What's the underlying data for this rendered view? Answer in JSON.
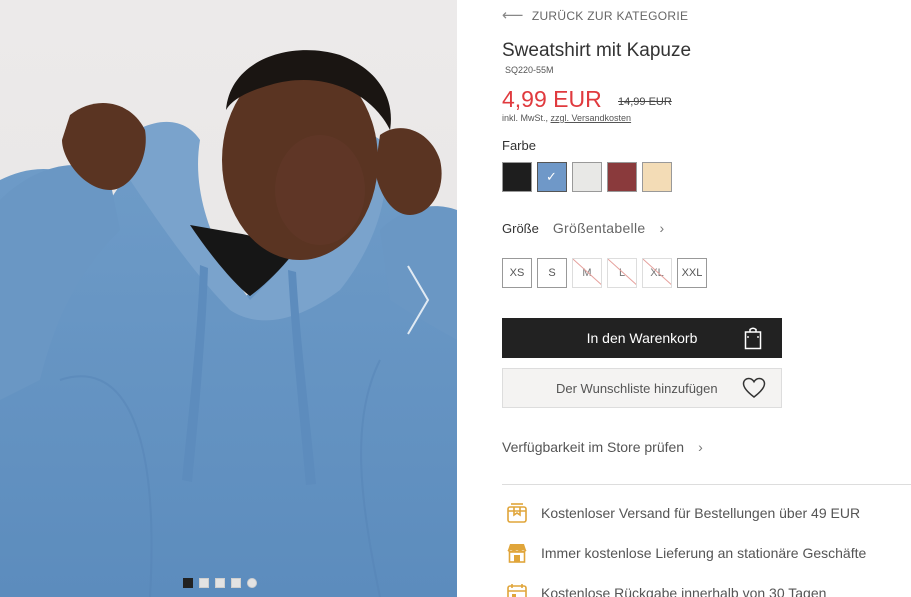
{
  "gallery": {
    "dots": [
      "active",
      "",
      "",
      "",
      "round"
    ]
  },
  "back_link": {
    "label": "ZURÜCK ZUR KATEGORIE"
  },
  "product": {
    "title": "Sweatshirt mit Kapuze",
    "sku": "SQ220-55M",
    "price": "4,99 EUR",
    "old_price": "14,99 EUR",
    "tax_prefix": "inkl. MwSt., ",
    "tax_link": "zzgl. Versandkosten"
  },
  "color": {
    "label": "Farbe",
    "swatches": [
      {
        "name": "black",
        "hex": "#1e1e1e",
        "selected": false
      },
      {
        "name": "blue",
        "hex": "#6f98c8",
        "selected": true
      },
      {
        "name": "light-grey",
        "hex": "#e8e8e6",
        "selected": false
      },
      {
        "name": "burgundy",
        "hex": "#8a3a3c",
        "selected": false
      },
      {
        "name": "beige",
        "hex": "#f3dcb6",
        "selected": false
      }
    ]
  },
  "size": {
    "label": "Größe",
    "table_link": "Größentabelle",
    "options": [
      {
        "label": "XS",
        "available": true
      },
      {
        "label": "S",
        "available": true
      },
      {
        "label": "M",
        "available": false
      },
      {
        "label": "L",
        "available": false
      },
      {
        "label": "XL",
        "available": false
      },
      {
        "label": "XXL",
        "available": true
      }
    ]
  },
  "actions": {
    "cart": "In den Warenkorb",
    "wishlist": "Der Wunschliste hinzufügen",
    "store_check": "Verfügbarkeit im Store prüfen"
  },
  "benefits": [
    {
      "icon": "delivery-box-icon",
      "text": "Kostenloser Versand für Bestellungen über 49 EUR"
    },
    {
      "icon": "store-icon",
      "text": "Immer kostenlose Lieferung an stationäre Geschäfte"
    },
    {
      "icon": "calendar-return-icon",
      "text": "Kostenlose Rückgabe innerhalb von 30 Tagen"
    }
  ],
  "colors": {
    "accent_price": "#e03a3e",
    "button_dark": "#222222",
    "icon_gold": "#e0a53a"
  }
}
